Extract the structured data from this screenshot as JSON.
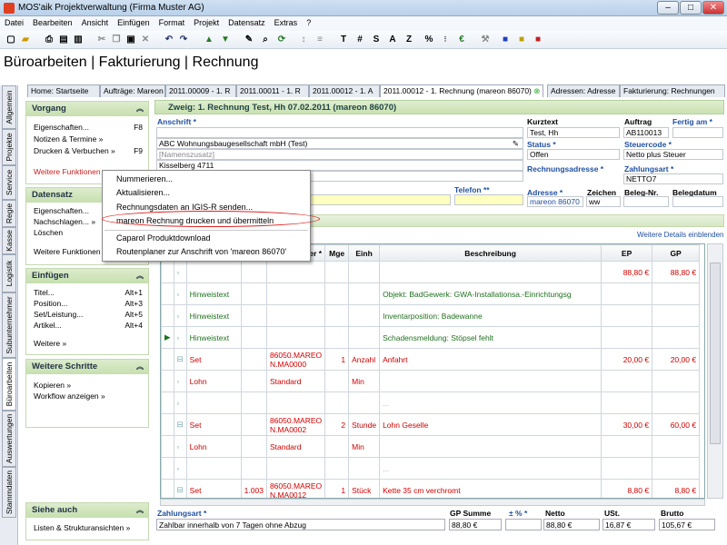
{
  "window": {
    "title": "MOS'aik Projektverwaltung (Firma Muster AG)",
    "min": "–",
    "max": "□",
    "close": "✕"
  },
  "menu": [
    "Datei",
    "Bearbeiten",
    "Ansicht",
    "Einfügen",
    "Format",
    "Projekt",
    "Datensatz",
    "Extras",
    "?"
  ],
  "toolbar": {
    "t": "T",
    "hash": "#",
    "s": "S",
    "a": "A",
    "z": "Z",
    "pct": "%"
  },
  "page_title": "Büroarbeiten | Fakturierung | Rechnung",
  "vtabs": [
    "Allgemein",
    "Projekte",
    "Service",
    "Regie",
    "Kasse",
    "Logistik",
    "Subunternehmer",
    "Büroarbeiten",
    "Auswertungen",
    "Stammdaten"
  ],
  "tabs": [
    "Home: Startseite",
    "Aufträge: Mareon",
    "2011.00009 - 1. R",
    "2011.00011 - 1. R",
    "2011.00012 - 1. A",
    "2011.00012 - 1. Rechnung (mareon 86070)",
    "Adressen: Adresse",
    "Fakturierung: Rechnungen"
  ],
  "sidebar": {
    "vorgang": {
      "title": "Vorgang",
      "items": [
        {
          "label": "Eigenschaften...",
          "key": "F8"
        },
        {
          "label": "Notizen & Termine »",
          "key": ""
        },
        {
          "label": "Drucken & Verbuchen »",
          "key": "F9"
        }
      ],
      "more": "Weitere Funktionen »"
    },
    "datensatz": {
      "title": "Datensatz",
      "items": [
        "Eigenschaften...",
        "Nachschlagen... »",
        "Löschen"
      ],
      "more": "Weitere Funktionen »",
      "star": "*"
    },
    "einfuegen": {
      "title": "Einfügen",
      "items": [
        {
          "label": "Titel...",
          "key": "Alt+1"
        },
        {
          "label": "Position...",
          "key": "Alt+3"
        },
        {
          "label": "Set/Leistung...",
          "key": "Alt+5"
        },
        {
          "label": "Artikel...",
          "key": "Alt+4"
        }
      ],
      "more": "Weitere »"
    },
    "schritte": {
      "title": "Weitere Schritte",
      "items": [
        "Kopieren »",
        "Workflow anzeigen »"
      ],
      "more": "Plugins »"
    },
    "siehe": {
      "title": "Siehe auch",
      "items": [
        "Listen & Strukturansichten »"
      ]
    }
  },
  "context_menu": [
    "Nummerieren...",
    "Aktualisieren...",
    "Rechnungsdaten an IGIS-R senden...",
    "mareon Rechnung drucken und übermitteln",
    "Caparol Produktdownload",
    "Routenplaner zur Anschrift von 'mareon 86070'"
  ],
  "form": {
    "header": "Zweig: 1. Rechnung Test, Hh 07.02.2011 (mareon 86070)",
    "anschrift_label": "Anschrift *",
    "anschrift": [
      "ABC Wohnungsbaugesellschaft mbH (Test)",
      "[Namenszusatz]",
      "Kisselberg 4711"
    ],
    "telefon_label": "Telefon **",
    "kurztext_label": "Kurztext",
    "kurztext": "Test, Hh",
    "auftrag_label": "Auftrag",
    "auftrag": "AB110013",
    "fertig_label": "Fertig am *",
    "status_label": "Status *",
    "status": "Offen",
    "steuercode_label": "Steuercode *",
    "steuercode": "Netto plus Steuer",
    "rechnungsadresse_label": "Rechnungsadresse *",
    "zahlungsart_label": "Zahlungsart *",
    "zahlungsart": "NETTO7",
    "adresse_label": "Adresse *",
    "adresse": "mareon 86070",
    "zeichen_label": "Zeichen",
    "zeichen": "ww",
    "belegnr_label": "Beleg-Nr.",
    "belegdatum_label": "Belegdatum",
    "details_link": "Weitere Details einblenden"
  },
  "table": {
    "headers": [
      "",
      "",
      "",
      "",
      "Nummer *",
      "Mge",
      "Einh",
      "Beschreibung",
      "EP",
      "GP"
    ],
    "rows": [
      {
        "type": "",
        "pos": "",
        "nummer": "",
        "mge": "",
        "einh": "",
        "beschr": "",
        "ep": "88,80 €",
        "gp": "88,80 €",
        "cls": "red"
      },
      {
        "type": "Hinweistext",
        "pos": "",
        "nummer": "",
        "mge": "",
        "einh": "",
        "beschr": "Objekt: BadGewerk: GWA-Installationsa.-Einrichtungsg",
        "ep": "",
        "gp": "",
        "cls": "grn"
      },
      {
        "type": "Hinweistext",
        "pos": "",
        "nummer": "",
        "mge": "",
        "einh": "",
        "beschr": "Inventarposition: Badewanne",
        "ep": "",
        "gp": "",
        "cls": "grn"
      },
      {
        "type": "Hinweistext",
        "pos": "",
        "nummer": "",
        "mge": "",
        "einh": "",
        "beschr": "Schadensmeldung: Stöpsel fehlt",
        "ep": "",
        "gp": "",
        "cls": "grn"
      },
      {
        "type": "Set",
        "pos": "",
        "nummer": "86050.MAREO N.MA0000",
        "mge": "1",
        "einh": "Anzahl",
        "beschr": "Anfahrt",
        "ep": "20,00 €",
        "gp": "20,00 €",
        "cls": "red"
      },
      {
        "type": "Lohn",
        "pos": "",
        "nummer": "Standard",
        "mge": "",
        "einh": "Min",
        "beschr": "",
        "ep": "",
        "gp": "",
        "cls": "red"
      },
      {
        "type": "",
        "pos": "",
        "nummer": "",
        "mge": "",
        "einh": "",
        "beschr": "...",
        "ep": "",
        "gp": "",
        "cls": ""
      },
      {
        "type": "Set",
        "pos": "",
        "nummer": "86050.MAREO N.MA0002",
        "mge": "2",
        "einh": "Stunde",
        "beschr": "Lohn Geselle",
        "ep": "30,00 €",
        "gp": "60,00 €",
        "cls": "red"
      },
      {
        "type": "Lohn",
        "pos": "",
        "nummer": "Standard",
        "mge": "",
        "einh": "Min",
        "beschr": "",
        "ep": "",
        "gp": "",
        "cls": "red"
      },
      {
        "type": "",
        "pos": "",
        "nummer": "",
        "mge": "",
        "einh": "",
        "beschr": "...",
        "ep": "",
        "gp": "",
        "cls": ""
      },
      {
        "type": "Set",
        "pos": "1.003",
        "nummer": "86050.MAREO N.MA0012",
        "mge": "1",
        "einh": "Stück",
        "beschr": "Kette 35 cm verchromt",
        "ep": "8,80 €",
        "gp": "8,80 €",
        "cls": "red"
      },
      {
        "type": "",
        "pos": "",
        "nummer": "",
        "mge": "",
        "einh": "",
        "beschr": "...",
        "ep": "",
        "gp": "",
        "cls": ""
      }
    ]
  },
  "footer": {
    "zahlungsart_label": "Zahlungsart *",
    "zahlungsart": "Zahlbar innerhalb von 7 Tagen ohne Abzug",
    "gpsumme_label": "GP Summe",
    "gpsumme": "88,80 €",
    "pct_label": "± % *",
    "pct": "",
    "netto_label": "Netto",
    "netto": "88,80 €",
    "ust_label": "USt.",
    "ust": "16,87 €",
    "brutto_label": "Brutto",
    "brutto": "105,67 €"
  }
}
